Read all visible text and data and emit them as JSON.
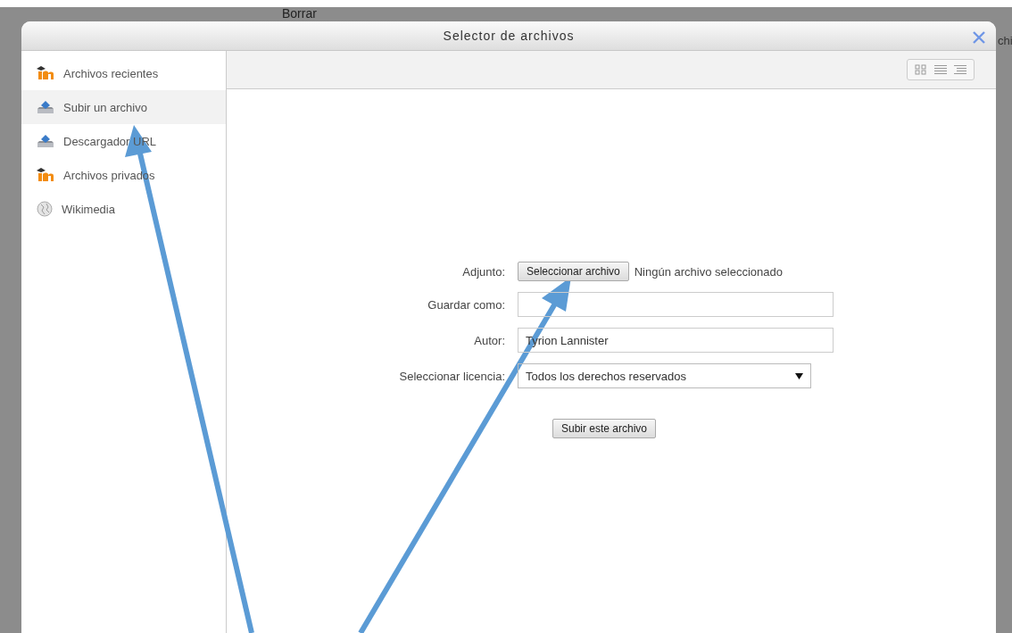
{
  "background": {
    "texts": [
      "Borrar",
      "chi"
    ]
  },
  "dialog": {
    "title": "Selector de archivos"
  },
  "sidebar": {
    "items": [
      {
        "label": "Archivos recientes",
        "kind": "moodle",
        "selected": false
      },
      {
        "label": "Subir un archivo",
        "kind": "upload",
        "selected": true
      },
      {
        "label": "Descargador URL",
        "kind": "upload",
        "selected": false
      },
      {
        "label": "Archivos privados",
        "kind": "moodle",
        "selected": false
      },
      {
        "label": "Wikimedia",
        "kind": "wiki",
        "selected": false
      }
    ]
  },
  "form": {
    "fields": [
      {
        "kind": "file",
        "label": "Adjunto:",
        "button": "Seleccionar archivo",
        "status": "Ningún archivo seleccionado"
      },
      {
        "kind": "text",
        "label": "Guardar como:"
      },
      {
        "kind": "text",
        "label": "Autor:",
        "value": "Tyrion Lannister"
      },
      {
        "kind": "select",
        "label": "Seleccionar licencia:",
        "value": "Todos los derechos reservados"
      }
    ],
    "submit": "Subir este archivo"
  }
}
